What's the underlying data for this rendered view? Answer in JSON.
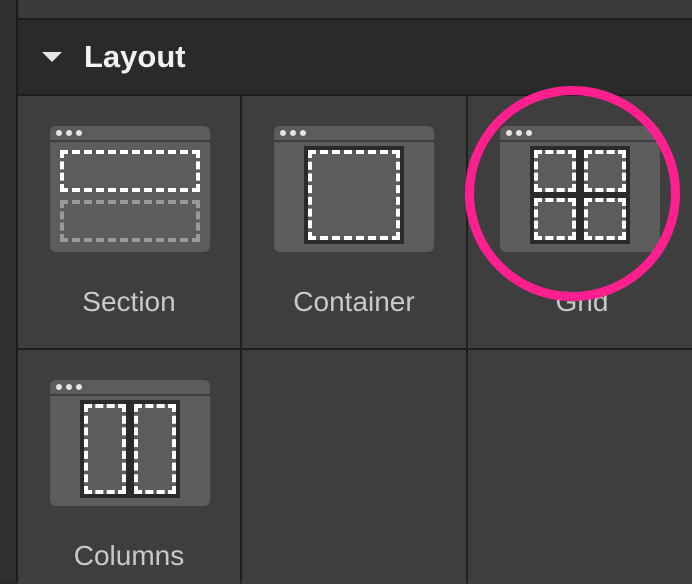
{
  "panel": {
    "section_title": "Layout"
  },
  "layout_items": [
    {
      "label": "Section",
      "icon": "section-icon"
    },
    {
      "label": "Container",
      "icon": "container-icon"
    },
    {
      "label": "Grid",
      "icon": "grid-icon"
    },
    {
      "label": "Columns",
      "icon": "columns-icon"
    }
  ],
  "annotation": {
    "highlight_color": "#ff1f8e"
  }
}
